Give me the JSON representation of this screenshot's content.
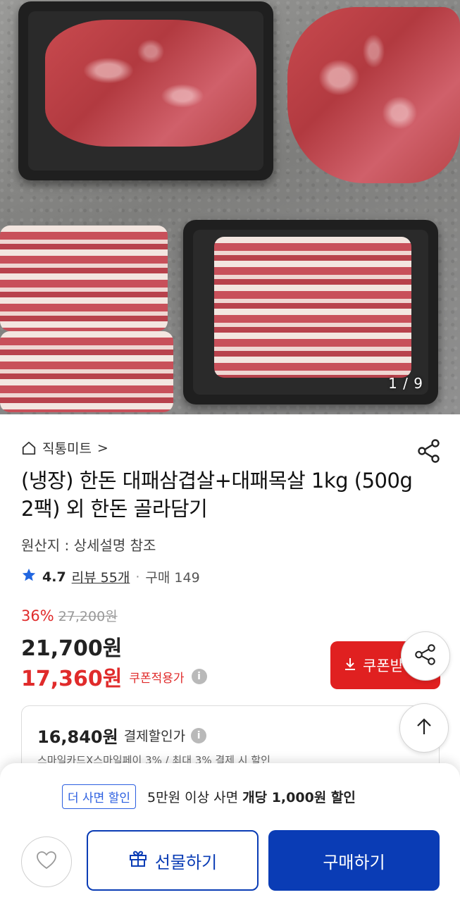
{
  "gallery": {
    "counter": "1 / 9"
  },
  "store": {
    "name": "직통미트",
    "chevron": ">"
  },
  "product": {
    "title": "(냉장) 한돈 대패삼겹살+대패목살 1kg (500g 2팩) 외 한돈 골라담기",
    "origin": "원산지 : 상세설명 참조",
    "rating": "4.7",
    "reviews": "리뷰 55개",
    "dot": "·",
    "purchases": "구매 149"
  },
  "pricing": {
    "discount_rate": "36%",
    "original_price": "27,200원",
    "price": "21,700원",
    "coupon_price": "17,360원",
    "coupon_label": "쿠폰적용가",
    "coupon_button": "쿠폰받",
    "payment_price": "16,840원",
    "payment_label": "결제할인가",
    "payment_sub": "스마일카드X스마일페이 3% / 최대 3% 결제 시 할인"
  },
  "bottom_bar": {
    "promo_badge": "더 사면 할인",
    "promo_text_prefix": "5만원 이상 사면",
    "promo_text_bold": "개당 1,000원 할인",
    "gift_label": "선물하기",
    "buy_label": "구매하기"
  },
  "colors": {
    "accent_red": "#e02020",
    "accent_blue": "#0a3cb5",
    "promo_blue": "#2c5fe0",
    "star_blue": "#2166e0"
  },
  "icons": [
    "home-icon",
    "share-icon",
    "star-icon",
    "info-icon",
    "download-icon",
    "arrow-up-icon",
    "heart-icon",
    "gift-icon"
  ]
}
